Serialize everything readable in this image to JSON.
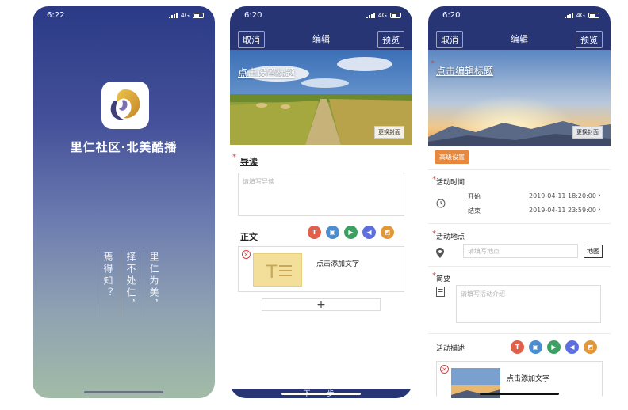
{
  "splash": {
    "time": "6:22",
    "network": "4G",
    "app_title": "里仁社区·北美酷播",
    "poem_columns": [
      "里仁为美，",
      "择不处仁，",
      "焉得知？"
    ]
  },
  "editor1": {
    "time": "6:20",
    "network": "4G",
    "cancel": "取消",
    "title": "编辑",
    "preview": "预览",
    "cover_title": "点击设置标题",
    "change_cover": "更换封面",
    "intro_label": "导读",
    "intro_placeholder": "请填写导读",
    "body_label": "正文",
    "card_caption": "点击添加文字",
    "add": "+",
    "bottom_button": "下一步"
  },
  "editor2": {
    "time": "6:20",
    "network": "4G",
    "cancel": "取消",
    "title": "编辑",
    "preview": "预览",
    "cover_title": "点击编辑标题",
    "change_cover": "更换封面",
    "advanced": "高级设置",
    "time_label": "活动时间",
    "start_label": "开始",
    "start_value": "2019-04-11 18:20:00",
    "end_label": "结束",
    "end_value": "2019-04-11 23:59:00",
    "location_label": "活动地点",
    "location_placeholder": "请填写地点",
    "map_button": "地图",
    "intro_label": "简要",
    "intro_placeholder": "请填写活动介绍",
    "desc_label": "活动描述",
    "card_caption": "点击添加文字"
  },
  "colors": {
    "nav": "#283575",
    "accent_orange": "#e6893e",
    "required_red": "#e04040"
  },
  "toolbar_icons": [
    "text-icon",
    "image-icon",
    "video-icon",
    "audio-icon",
    "gallery-icon"
  ]
}
